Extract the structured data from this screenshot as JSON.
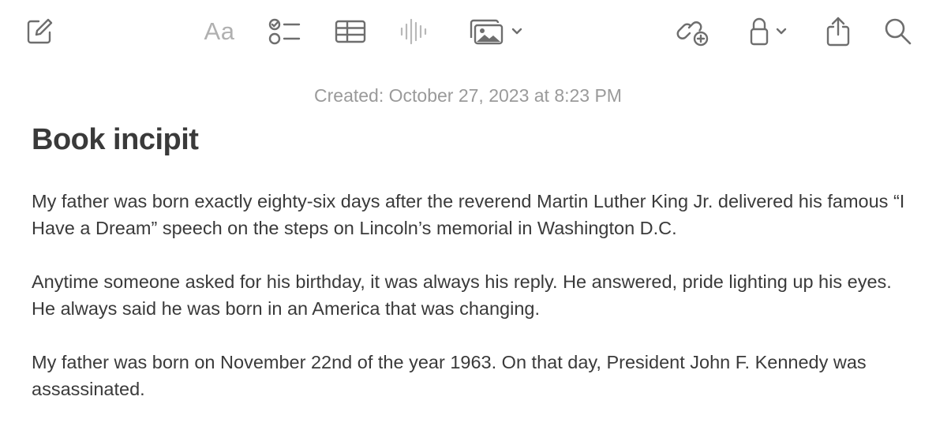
{
  "toolbar": {
    "compose_icon": "compose-icon",
    "format_label": "Aa",
    "checklist_icon": "checklist-icon",
    "table_icon": "table-icon",
    "audio_icon": "waveform-icon",
    "media_icon": "photo-icon",
    "collaborate_icon": "link-plus-icon",
    "lock_icon": "lock-icon",
    "share_icon": "share-icon",
    "search_icon": "search-icon"
  },
  "note": {
    "created": "Created: October 27, 2023 at 8:23 PM",
    "title": "Book incipit",
    "paragraphs": [
      "My father was born exactly eighty-six days after the reverend Martin Luther King Jr. delivered his famous “I Have a Dream” speech on the steps on Lincoln’s memorial in Washington D.C.",
      "Anytime someone asked for his birthday, it was always his reply. He answered, pride lighting up his eyes. He always said he was born in an America that was changing.",
      "My father was born on November 22nd of the year 1963. On that day, President John F. Kennedy was assassinated."
    ]
  },
  "colors": {
    "icon": "#6e6e6e",
    "icon_disabled": "#b8b8b8",
    "text": "#3a3a3a",
    "meta_text": "#9a9a9a"
  }
}
